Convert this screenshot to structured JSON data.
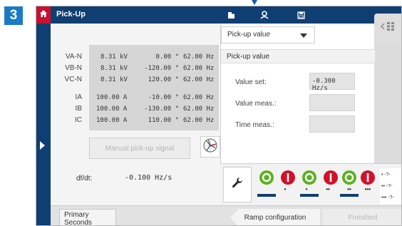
{
  "step_number": "3",
  "title": "Pick-Up",
  "icons": {
    "home": "home-icon",
    "folder": "folder-icon",
    "user": "user-icon",
    "save": "save-icon",
    "nav": "grid-nav-icon",
    "expand": "expand-arrow-icon",
    "phasor": "phasor-diagram-icon",
    "wrench": "wrench-icon"
  },
  "colors": {
    "title_bar": "#0f3e72",
    "home_accent": "#c8102e",
    "led_green": "#5bb21d",
    "led_red": "#d0112b",
    "step_badge": "#1a7bc4"
  },
  "measurements": [
    {
      "label": "VA-N",
      "magnitude": "8.31 kV",
      "angle": "0.00 °",
      "freq": "62.00 Hz"
    },
    {
      "label": "VB-N",
      "magnitude": "8.31 kV",
      "angle": "-120.00 °",
      "freq": "62.00 Hz"
    },
    {
      "label": "VC-N",
      "magnitude": "8.31 kV",
      "angle": "120.00 °",
      "freq": "62.00 Hz"
    },
    {
      "label": "IA",
      "magnitude": "100.00 A",
      "angle": "-10.00 °",
      "freq": "62.00 Hz"
    },
    {
      "label": "IB",
      "magnitude": "100.00 A",
      "angle": "-130.00 °",
      "freq": "62.00 Hz"
    },
    {
      "label": "IC",
      "magnitude": "100.00 A",
      "angle": "110.00 °",
      "freq": "62.00 Hz"
    }
  ],
  "manual_pickup_label": "Manual pick-up signal",
  "dfdt": {
    "label": "df/dt:",
    "value": "-0.100 Hz/s"
  },
  "dropdown": {
    "selected": "Pick-up value"
  },
  "section_title": "Pick-up value",
  "fields": [
    {
      "label": "Value set:",
      "value": "-0.300 Hz/s"
    },
    {
      "label": "Value meas.:",
      "value": ""
    },
    {
      "label": "Time meas.:",
      "value": ""
    }
  ],
  "leds": [
    {
      "color": "green",
      "symbol": "O",
      "marker": "•"
    },
    {
      "color": "red",
      "symbol": "I",
      "marker": "•"
    },
    {
      "color": "green",
      "symbol": "O",
      "marker": "••"
    },
    {
      "color": "red",
      "symbol": "I",
      "marker": "••"
    },
    {
      "color": "green",
      "symbol": "O",
      "marker": "•••"
    },
    {
      "color": "red",
      "symbol": "I",
      "marker": "•••"
    }
  ],
  "legend": [
    {
      "marker": "•",
      "text": "-?-"
    },
    {
      "marker": "••",
      "text": "-?-"
    },
    {
      "marker": "•••",
      "text": "-?-"
    }
  ],
  "bottom": {
    "primary_line1": "Primary",
    "primary_line2": "Seconds",
    "ramp_label": "Ramp configuration",
    "finished_label": "Finished"
  }
}
